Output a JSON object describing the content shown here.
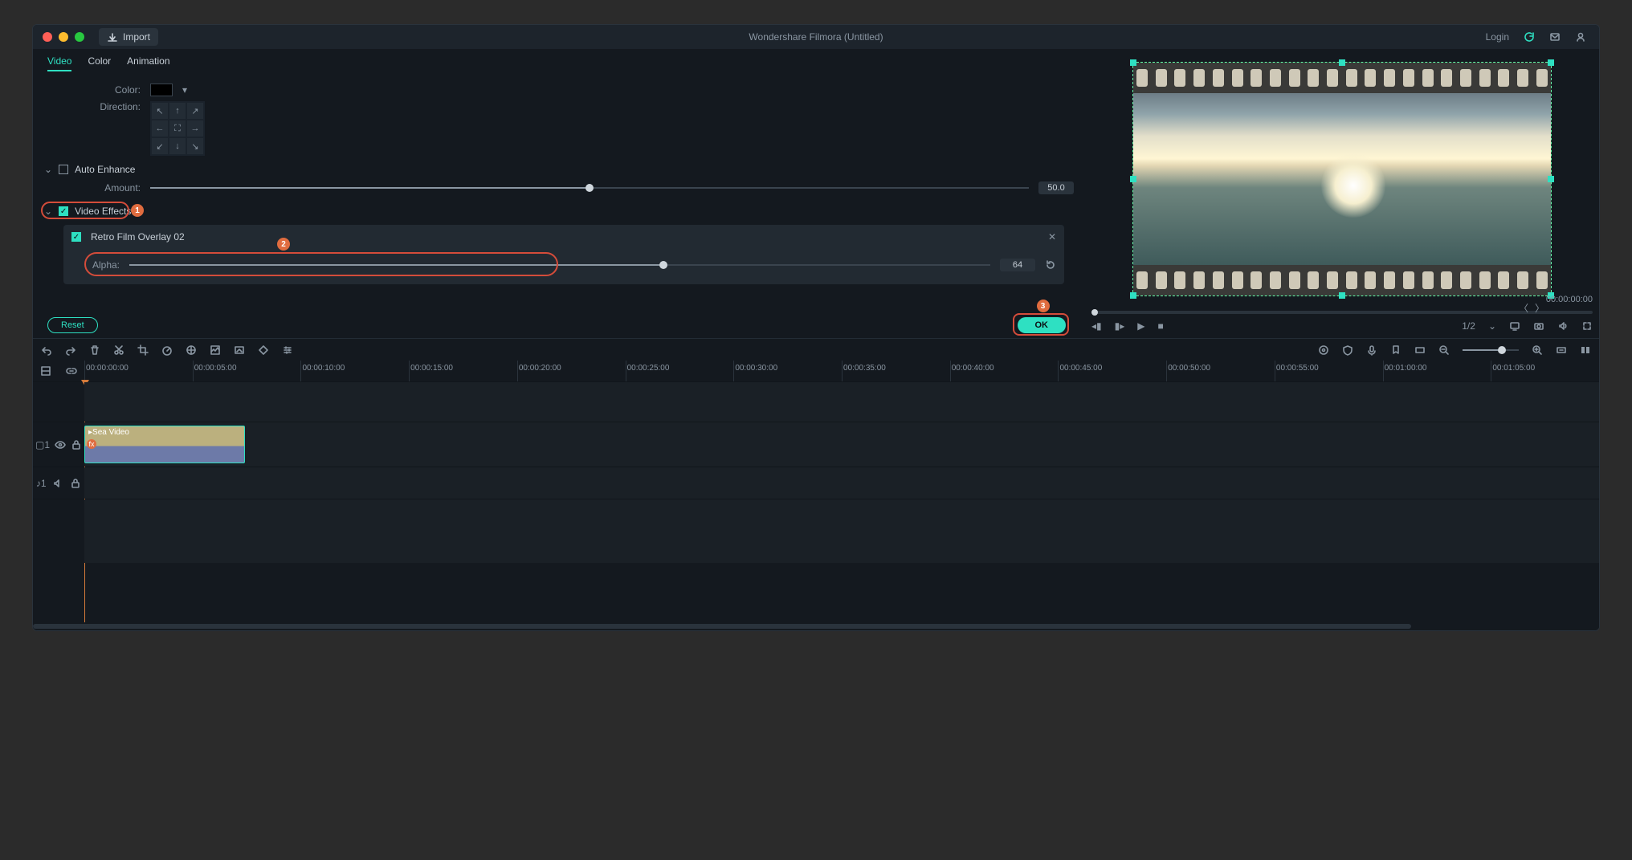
{
  "app_title": "Wondershare Filmora (Untitled)",
  "titlebar": {
    "import": "Import",
    "login": "Login"
  },
  "tabs": [
    "Video",
    "Color",
    "Animation"
  ],
  "color_row": {
    "label": "Color:"
  },
  "direction": {
    "label": "Direction:"
  },
  "auto_enhance": {
    "title": "Auto Enhance",
    "amount_label": "Amount:",
    "amount_value": "50.0",
    "amount_pct": 50
  },
  "video_effects": {
    "title": "Video Effects",
    "effect_name": "Retro Film Overlay 02",
    "alpha_label": "Alpha:",
    "alpha_value": "64",
    "alpha_pct": 62
  },
  "buttons": {
    "reset": "Reset",
    "ok": "OK"
  },
  "annotations": {
    "n1": "1",
    "n2": "2",
    "n3": "3"
  },
  "preview": {
    "time": "00:00:00:00",
    "ratio": "1/2"
  },
  "clip": {
    "name": "Sea Video"
  },
  "ruler": [
    "00:00:00:00",
    "00:00:05:00",
    "00:00:10:00",
    "00:00:15:00",
    "00:00:20:00",
    "00:00:25:00",
    "00:00:30:00",
    "00:00:35:00",
    "00:00:40:00",
    "00:00:45:00",
    "00:00:50:00",
    "00:00:55:00",
    "00:01:00:00",
    "00:01:05:00"
  ],
  "track_labels": {
    "video": "1",
    "audio": "1"
  }
}
